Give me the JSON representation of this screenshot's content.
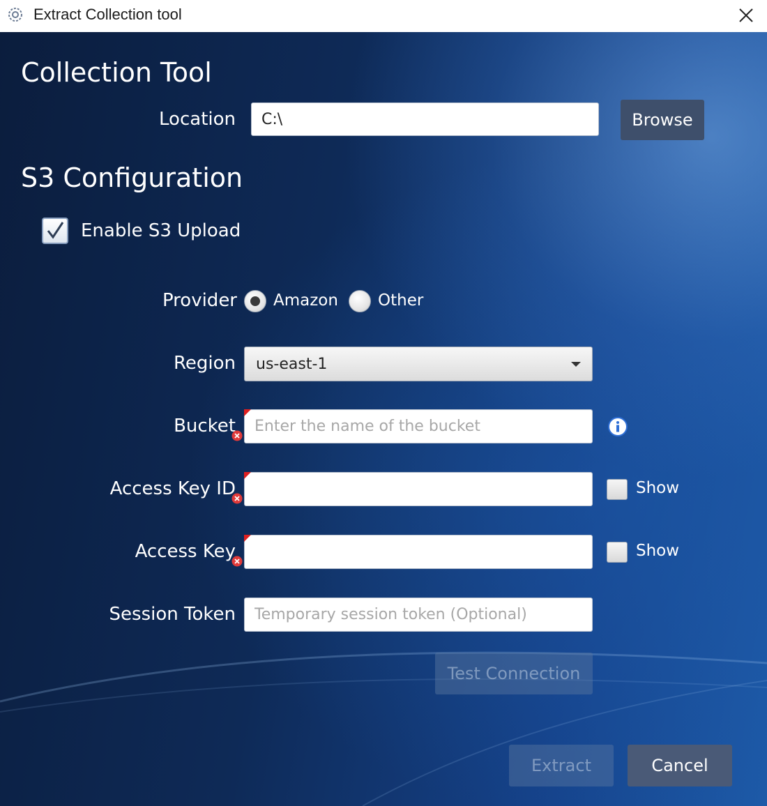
{
  "window": {
    "title": "Extract Collection tool"
  },
  "collection_tool": {
    "heading": "Collection Tool",
    "location_label": "Location",
    "location_value": "C:\\",
    "browse_label": "Browse"
  },
  "s3": {
    "heading": "S3 Configuration",
    "enable_label": "Enable S3 Upload",
    "enable_checked": true,
    "provider_label": "Provider",
    "provider_options": [
      "Amazon",
      "Other"
    ],
    "provider_selected": "Amazon",
    "region_label": "Region",
    "region_value": "us-east-1",
    "bucket_label": "Bucket",
    "bucket_placeholder": "Enter the name of the bucket",
    "access_key_id_label": "Access Key ID",
    "access_key_label": "Access Key",
    "show_label": "Show",
    "session_token_label": "Session Token",
    "session_token_placeholder": "Temporary session token (Optional)",
    "test_connection_label": "Test Connection"
  },
  "footer": {
    "extract_label": "Extract",
    "cancel_label": "Cancel"
  },
  "colors": {
    "required_marker": "#e02020",
    "button_bg": "#3e4f6b",
    "info_icon": "#2f6fd6"
  }
}
